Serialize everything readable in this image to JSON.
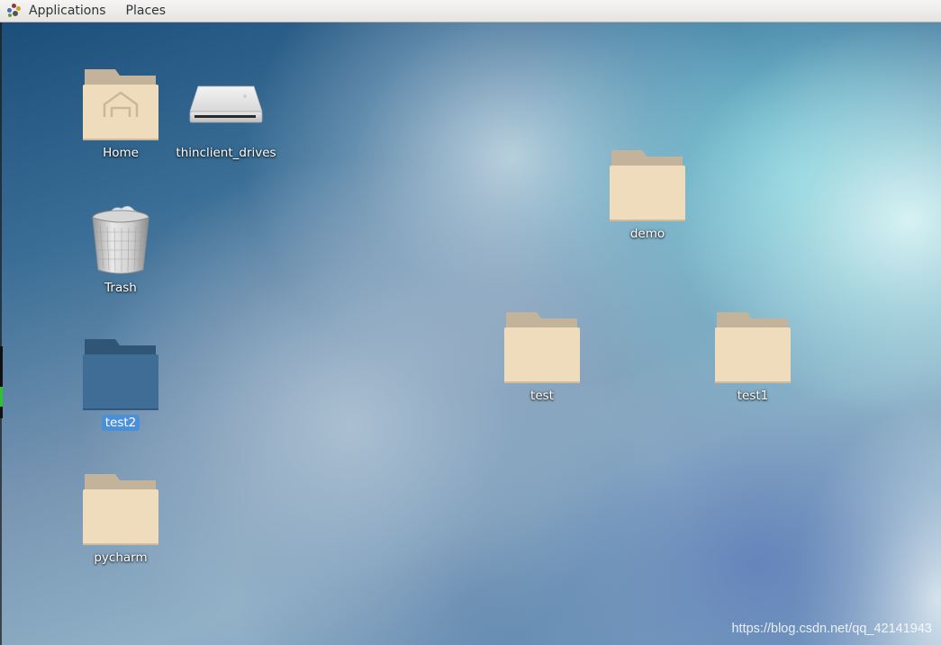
{
  "topbar": {
    "applications_label": "Applications",
    "places_label": "Places"
  },
  "desktop": {
    "icons": [
      {
        "label": "Home",
        "icon": "home-folder-icon"
      },
      {
        "label": "thinclient_drives",
        "icon": "drive-icon"
      },
      {
        "label": "Trash",
        "icon": "trash-icon"
      },
      {
        "label": "test2",
        "icon": "folder-icon",
        "selected": true
      },
      {
        "label": "pycharm",
        "icon": "folder-icon"
      },
      {
        "label": "demo",
        "icon": "folder-icon"
      },
      {
        "label": "test",
        "icon": "folder-icon"
      },
      {
        "label": "test1",
        "icon": "folder-icon"
      }
    ]
  },
  "colors": {
    "folder": "#eedcbc",
    "folder_tab": "#c2b39a",
    "folder_selected": "#3f6d95",
    "selection": "#4a90d9"
  },
  "watermark": "https://blog.csdn.net/qq_42141943"
}
